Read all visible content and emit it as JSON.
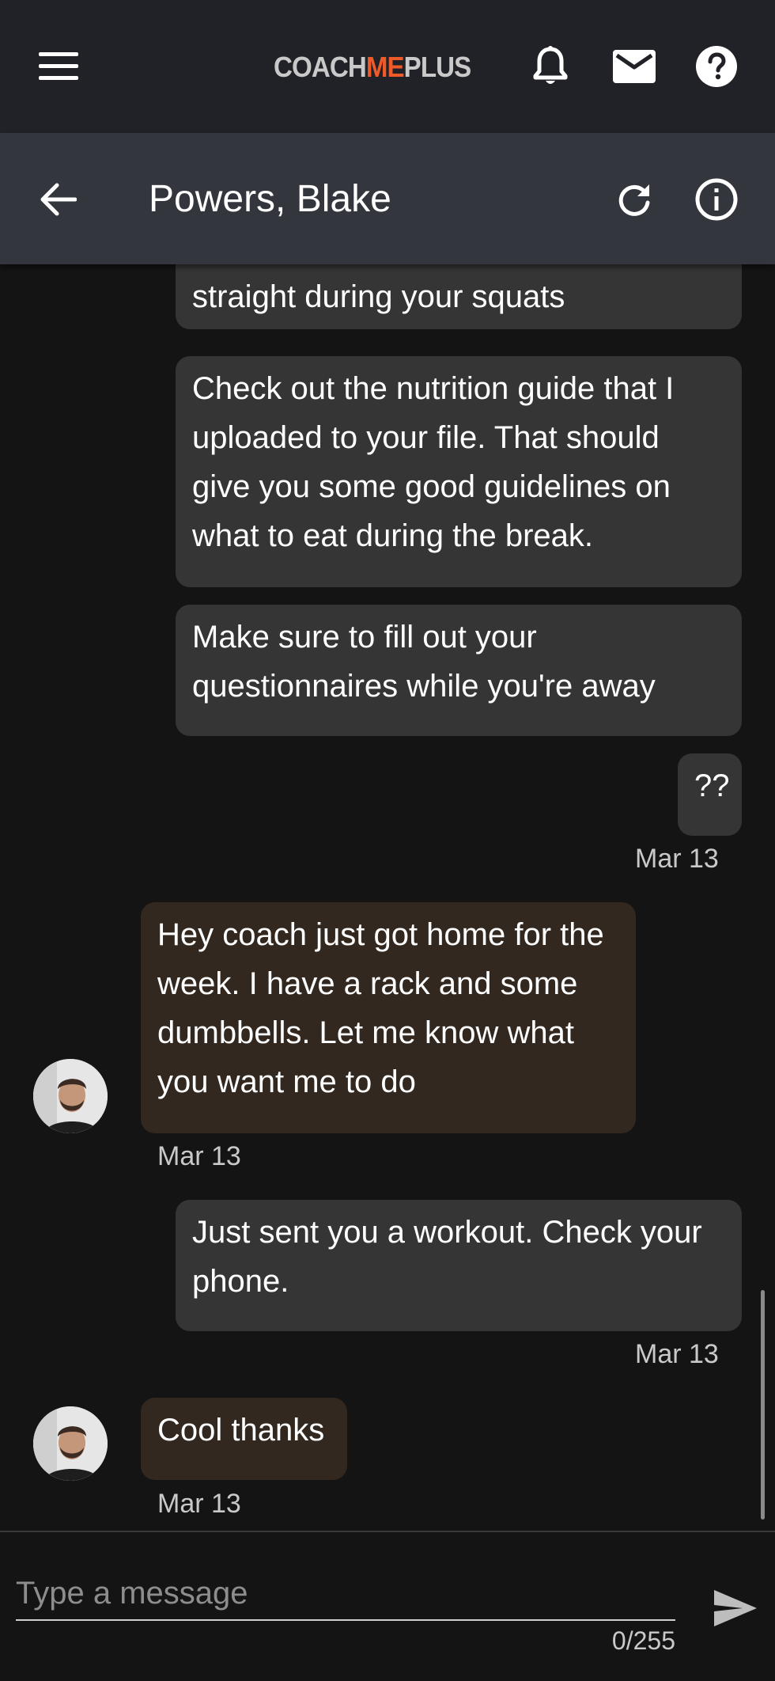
{
  "app": {
    "logo": {
      "part1": "COACH",
      "part2": "ME",
      "part3": "PLUS"
    },
    "colors": {
      "accent": "#ef5a2a",
      "topbar": "#202227",
      "subheader": "#33373d",
      "bubble_out": "#353535",
      "bubble_in": "#33281f"
    }
  },
  "toolbar": {
    "menu_icon": "hamburger-menu-icon",
    "notifications_icon": "bell-icon",
    "mail_icon": "envelope-icon",
    "help_icon": "help-circle-icon"
  },
  "conversation": {
    "title": "Powers, Blake",
    "back_icon": "arrow-left-icon",
    "refresh_icon": "refresh-icon",
    "info_icon": "info-icon"
  },
  "messages": [
    {
      "direction": "out",
      "text": "straight during your squats"
    },
    {
      "direction": "out",
      "text": "Check out the nutrition guide that I uploaded to your file. That should give you some good guidelines on what to eat during the break."
    },
    {
      "direction": "out",
      "text": "Make sure to fill out your questionnaires while you're away"
    },
    {
      "direction": "out",
      "text": "??",
      "time": "Mar 13"
    },
    {
      "direction": "in",
      "text": "Hey coach just got home for the week. I have a rack and some dumbbells. Let me know what you want me to do",
      "time": "Mar 13"
    },
    {
      "direction": "out",
      "text": "Just sent you a workout. Check your phone.",
      "time": "Mar 13"
    },
    {
      "direction": "in",
      "text": "Cool thanks",
      "time": "Mar 13"
    }
  ],
  "composer": {
    "placeholder": "Type a message",
    "value": "",
    "counter": "0/255",
    "send_icon": "send-icon"
  }
}
